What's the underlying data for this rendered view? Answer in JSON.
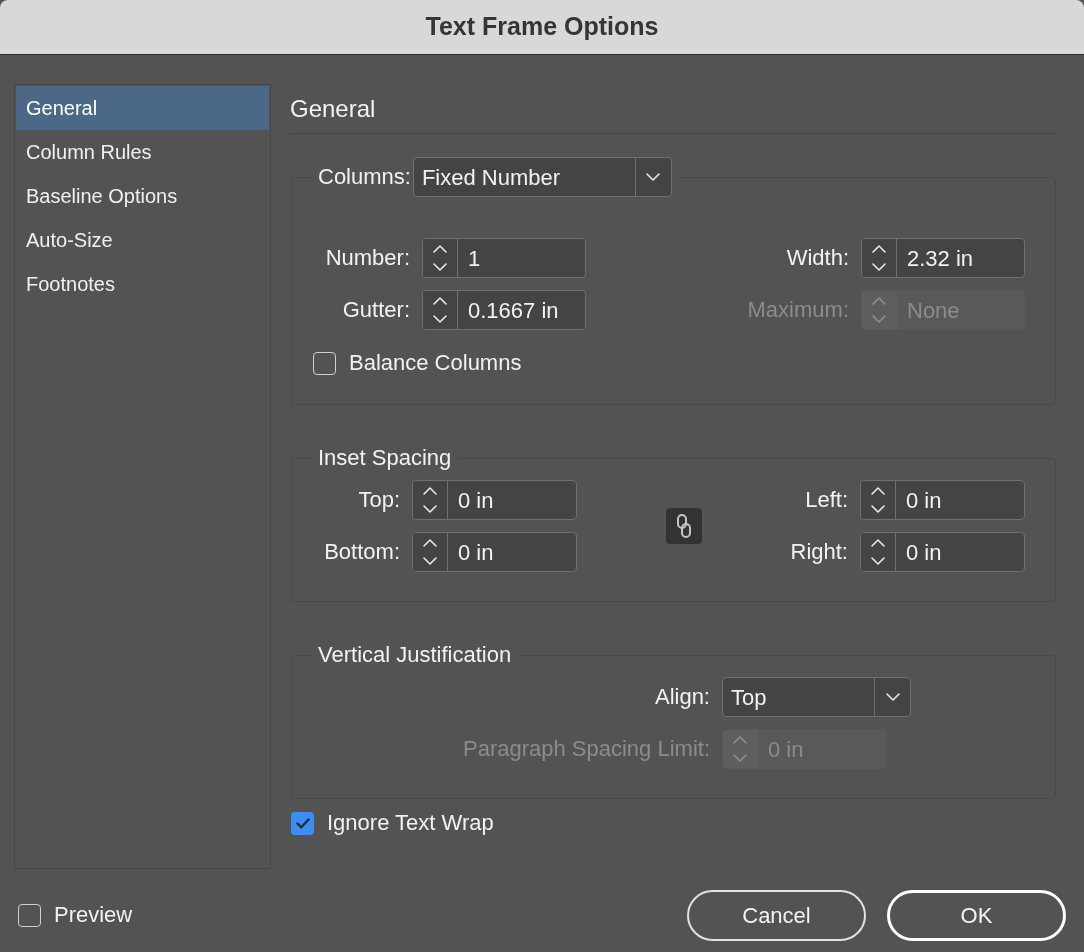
{
  "window": {
    "title": "Text Frame Options"
  },
  "sidebar": {
    "items": [
      {
        "label": "General",
        "selected": true
      },
      {
        "label": "Column Rules",
        "selected": false
      },
      {
        "label": "Baseline Options",
        "selected": false
      },
      {
        "label": "Auto-Size",
        "selected": false
      },
      {
        "label": "Footnotes",
        "selected": false
      }
    ]
  },
  "panel": {
    "heading": "General",
    "columns": {
      "label": "Columns:",
      "dropdown": {
        "value": "Fixed Number"
      },
      "fields": [
        {
          "label": "Number:",
          "value": "1",
          "disabled": false
        },
        {
          "label": "Width:",
          "value": "2.32 in",
          "disabled": false
        },
        {
          "label": "Gutter:",
          "value": "0.1667 in",
          "disabled": false
        },
        {
          "label": "Maximum:",
          "value": "None",
          "disabled": true
        }
      ],
      "balance_columns": {
        "label": "Balance Columns",
        "checked": false
      }
    },
    "inset_spacing": {
      "title": "Inset Spacing",
      "left_fields": [
        {
          "label": "Top:",
          "value": "0 in"
        },
        {
          "label": "Bottom:",
          "value": "0 in"
        }
      ],
      "right_fields": [
        {
          "label": "Left:",
          "value": "0 in"
        },
        {
          "label": "Right:",
          "value": "0 in"
        }
      ]
    },
    "vertical_justification": {
      "title": "Vertical Justification",
      "align": {
        "label": "Align:",
        "value": "Top"
      },
      "paragraph_spacing_limit": {
        "label": "Paragraph Spacing Limit:",
        "value": "0 in",
        "disabled": true
      }
    },
    "ignore_text_wrap": {
      "label": "Ignore Text Wrap",
      "checked": true
    }
  },
  "footer": {
    "preview": {
      "label": "Preview",
      "checked": false
    },
    "buttons": [
      {
        "label": "Cancel",
        "default": false
      },
      {
        "label": "OK",
        "default": true
      }
    ]
  }
}
